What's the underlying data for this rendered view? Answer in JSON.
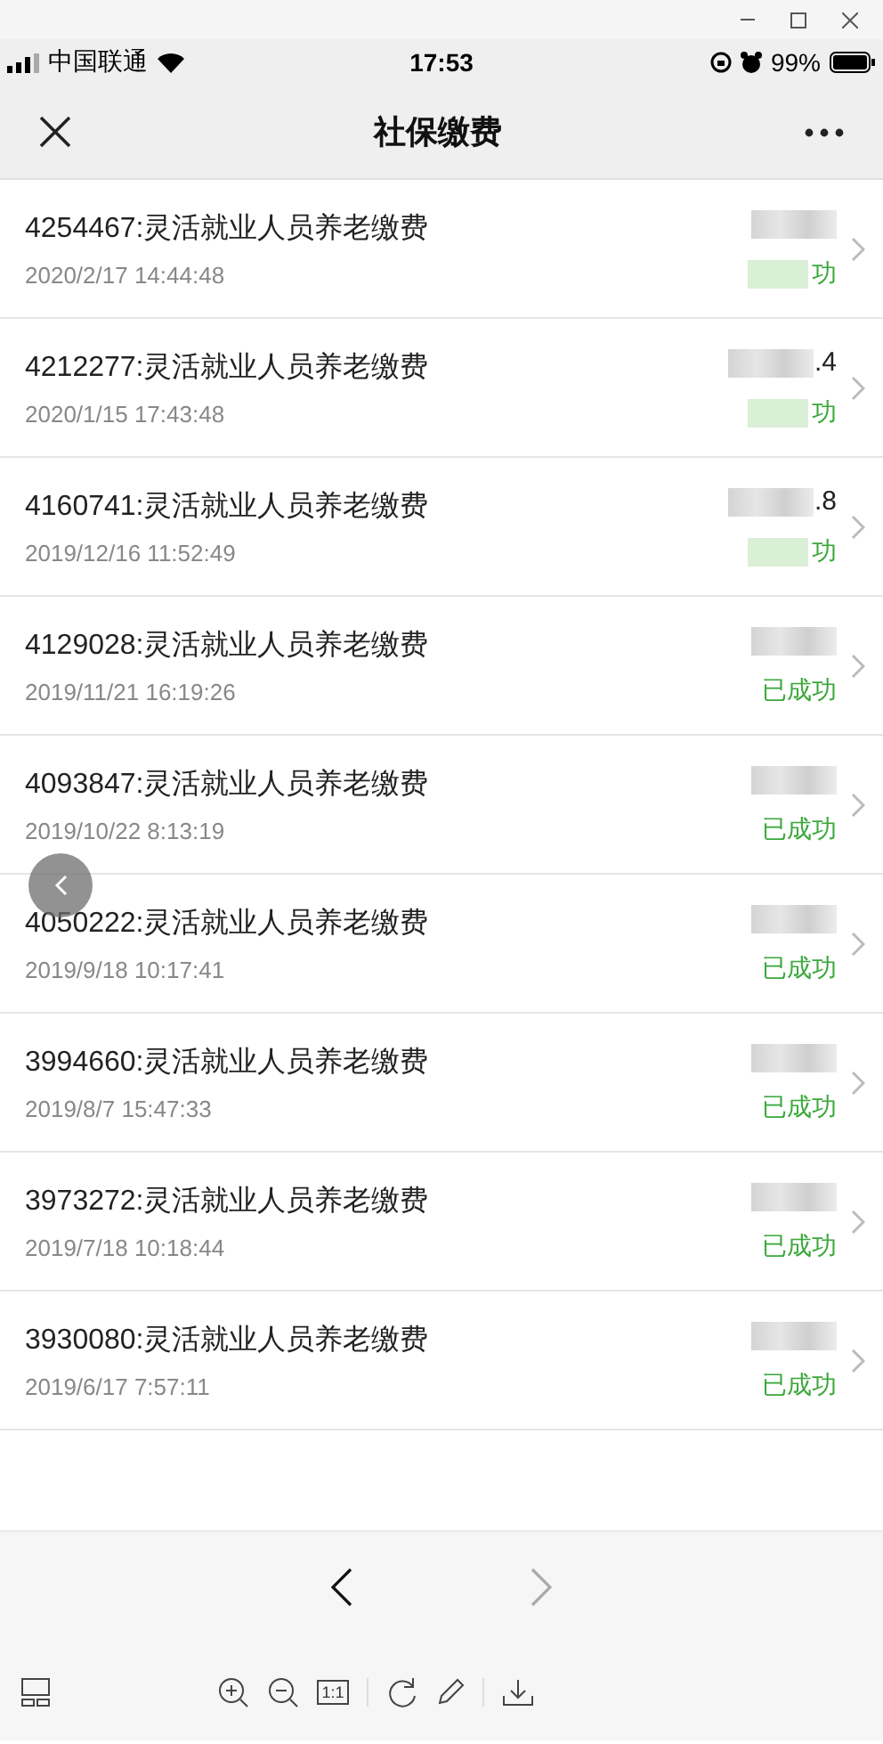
{
  "status_bar": {
    "carrier": "中国联通",
    "time": "17:53",
    "battery": "99%"
  },
  "nav": {
    "title": "社保缴费"
  },
  "records": [
    {
      "title": "4254467:灵活就业人员养老缴费",
      "time": "2020/2/17 14:44:48",
      "status": "功"
    },
    {
      "title": "4212277:灵活就业人员养老缴费",
      "time": "2020/1/15 17:43:48",
      "amount": ".4",
      "status": "功"
    },
    {
      "title": "4160741:灵活就业人员养老缴费",
      "time": "2019/12/16 11:52:49",
      "amount": ".8",
      "status": "功"
    },
    {
      "title": "4129028:灵活就业人员养老缴费",
      "time": "2019/11/21 16:19:26",
      "status": "已成功"
    },
    {
      "title": "4093847:灵活就业人员养老缴费",
      "time": "2019/10/22 8:13:19",
      "status": "已成功"
    },
    {
      "title": "4050222:灵活就业人员养老缴费",
      "time": "2019/9/18 10:17:41",
      "status": "已成功"
    },
    {
      "title": "3994660:灵活就业人员养老缴费",
      "time": "2019/8/7 15:47:33",
      "status": "已成功"
    },
    {
      "title": "3973272:灵活就业人员养老缴费",
      "time": "2019/7/18 10:18:44",
      "status": "已成功"
    },
    {
      "title": "3930080:灵活就业人员养老缴费",
      "time": "2019/6/17 7:57:11",
      "status": "已成功"
    }
  ],
  "viewer": {
    "actual_size_label": "1:1",
    "next_disabled": true
  }
}
